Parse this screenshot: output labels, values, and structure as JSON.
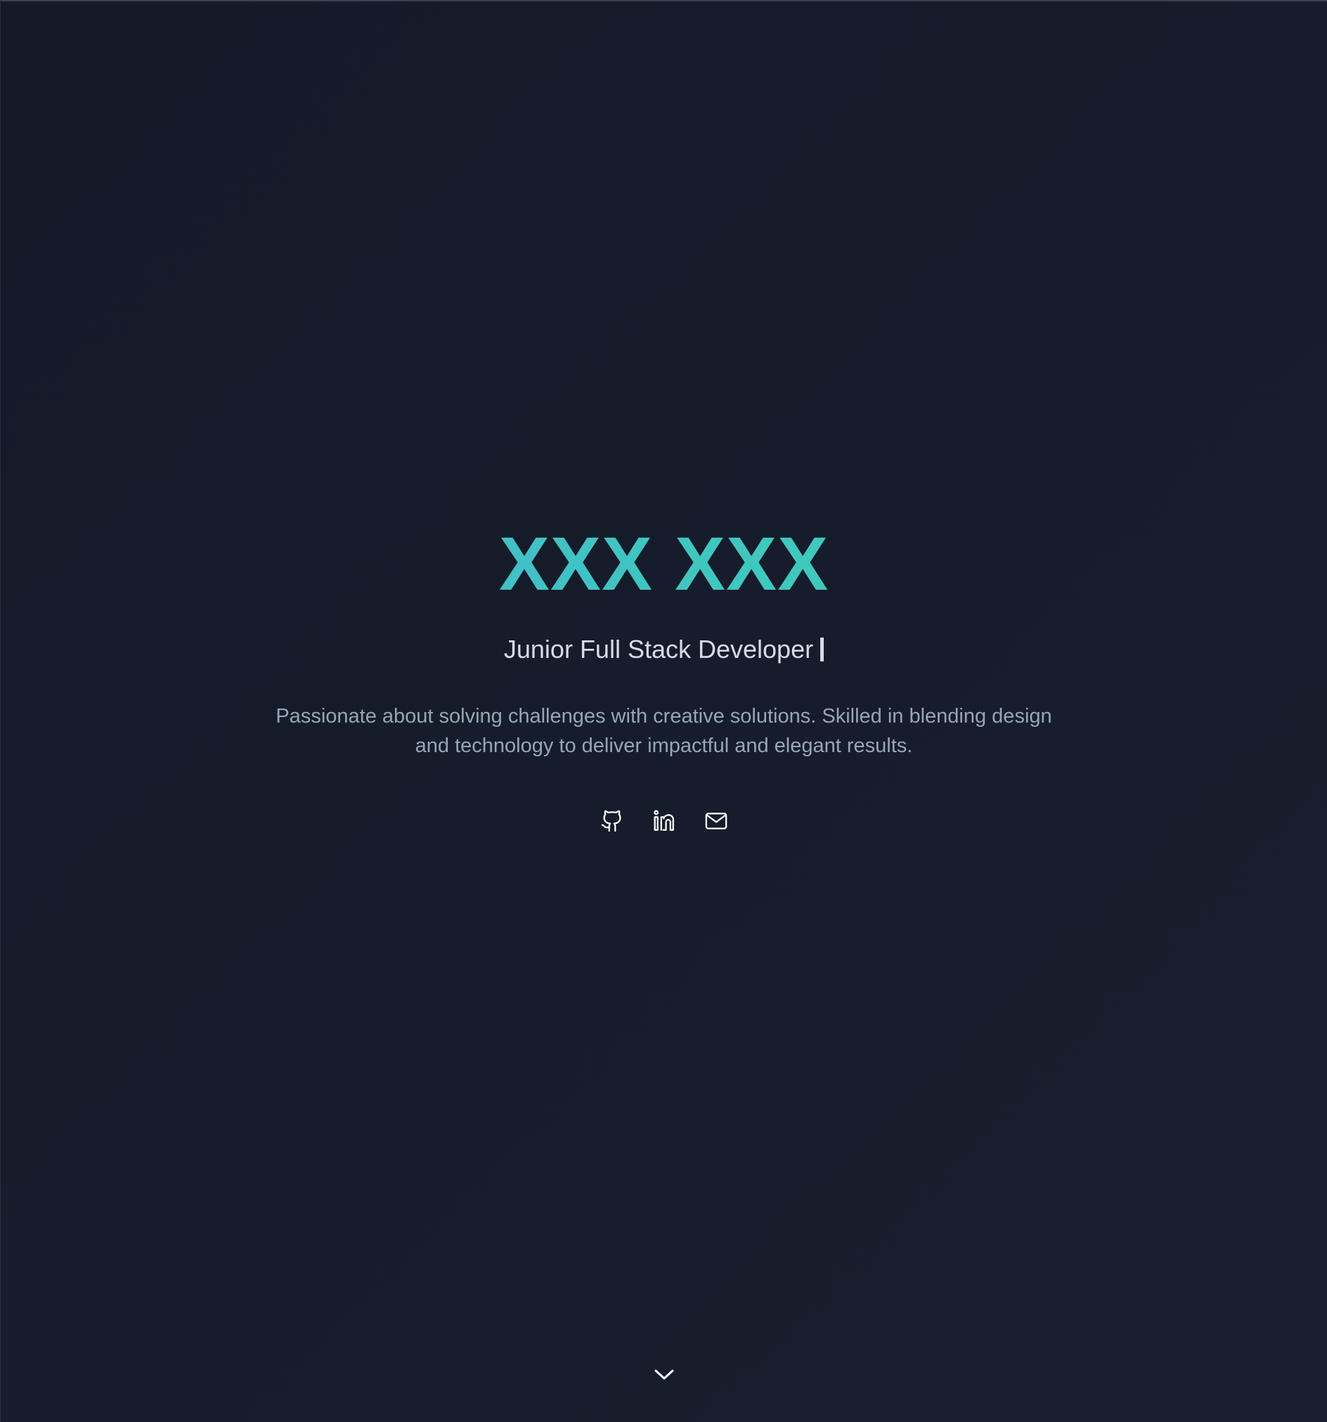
{
  "hero": {
    "name": "XXX XXX",
    "role": "Junior Full Stack Developer",
    "bio": "Passionate about solving challenges with creative solutions. Skilled in blending design and technology to deliver impactful and elegant results."
  },
  "socials": [
    {
      "icon": "github-icon"
    },
    {
      "icon": "linkedin-icon"
    },
    {
      "icon": "mail-icon"
    }
  ],
  "scroll": {
    "icon": "chevron-down-icon"
  },
  "colors": {
    "background": "#151c2b",
    "gradient_start": "#4aaee0",
    "gradient_end": "#3fd0b0",
    "role_text": "#d6dde8",
    "bio_text": "#9aa4b6",
    "icon": "#ffffff"
  }
}
